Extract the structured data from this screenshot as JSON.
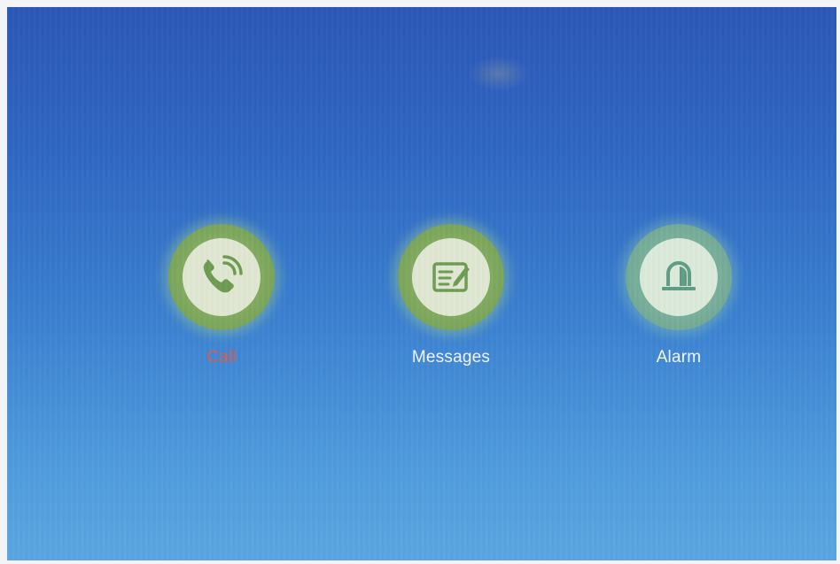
{
  "menu": {
    "items": [
      {
        "label": "Call",
        "icon": "phone-icon",
        "selected": true,
        "label_color": "#e05a4a"
      },
      {
        "label": "Messages",
        "icon": "message-edit-icon",
        "selected": false,
        "label_color": "#f4f6fa"
      },
      {
        "label": "Alarm",
        "icon": "alarm-siren-icon",
        "selected": false,
        "label_color": "#f4f6fa"
      }
    ]
  },
  "colors": {
    "background_top": "#2b57b7",
    "background_bottom": "#5aa6e1",
    "icon_ring": "#7ea85d",
    "icon_inner": "#dfe7d2",
    "icon_glyph": "#6e9b52"
  }
}
